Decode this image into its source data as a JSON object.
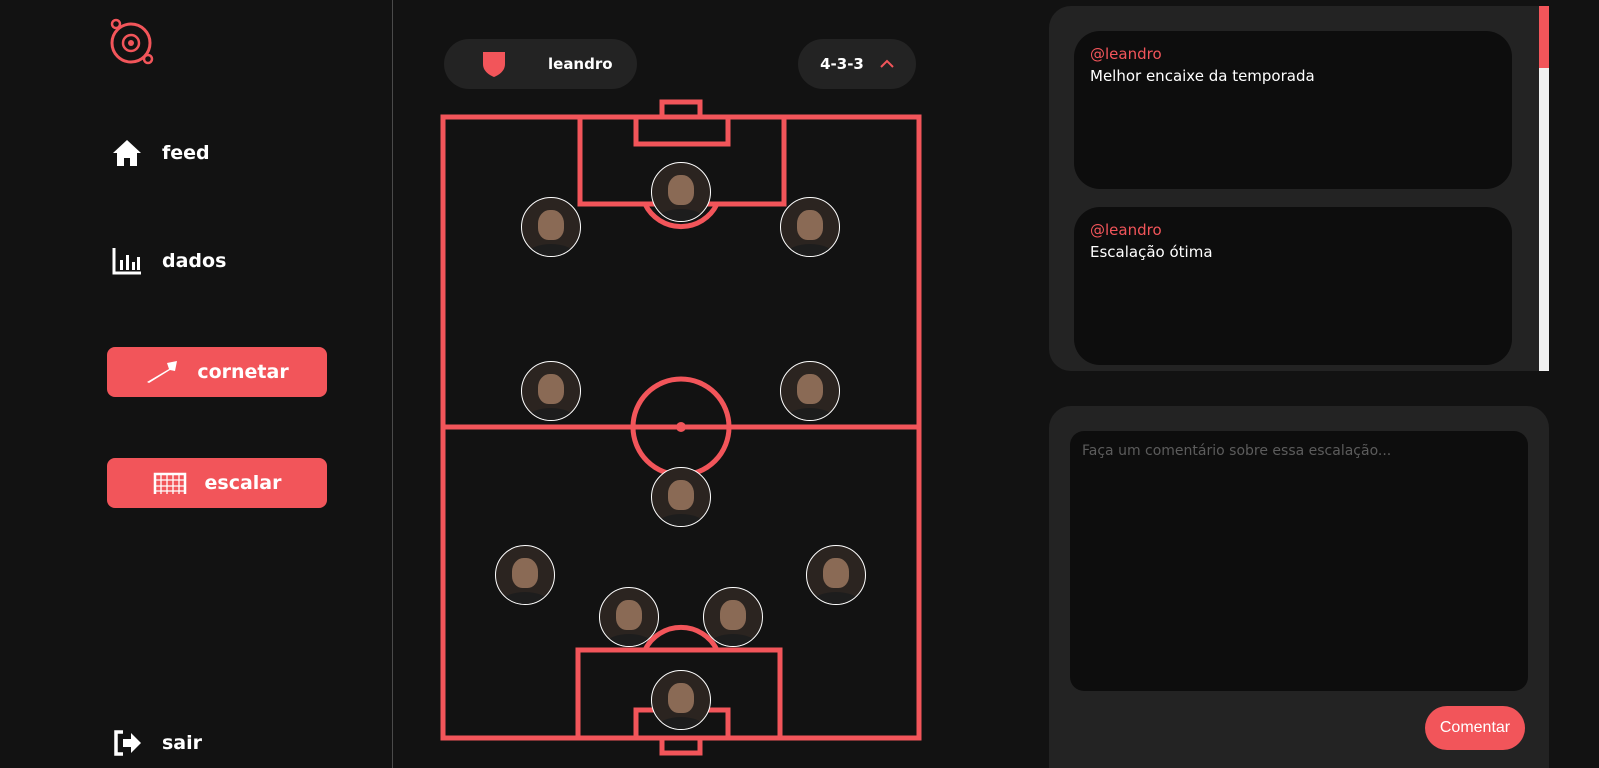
{
  "sidebar": {
    "nav": [
      {
        "label": "feed",
        "icon": "home-icon"
      },
      {
        "label": "dados",
        "icon": "bar-chart-icon"
      },
      {
        "label": "cornetar",
        "icon": "horn-icon"
      },
      {
        "label": "escalar",
        "icon": "goal-net-icon"
      },
      {
        "label": "sair",
        "icon": "logout-icon"
      }
    ]
  },
  "lineup": {
    "team_name": "leandro",
    "formation": "4-3-3"
  },
  "comments": [
    {
      "user": "@leandro",
      "text": "Melhor encaixe da temporada"
    },
    {
      "user": "@leandro",
      "text": "Escalação ótima"
    }
  ],
  "compose": {
    "placeholder": "Faça um comentário sobre essa escalação...",
    "submit_label": "Comentar"
  },
  "colors": {
    "accent": "#f2555a",
    "background": "#121212",
    "panel": "#232323",
    "card": "#0d0d0d"
  }
}
